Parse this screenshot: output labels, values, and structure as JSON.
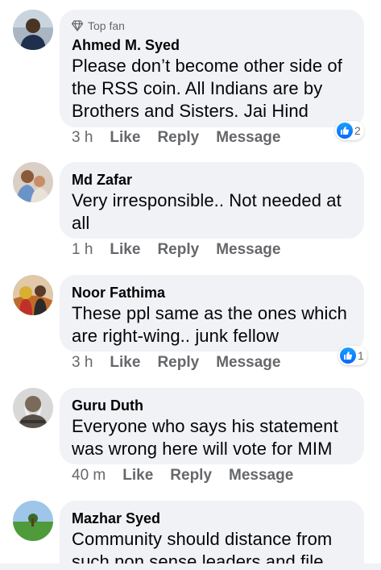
{
  "colors": {
    "bubble": "#f0f2f5",
    "meta_text": "#65676b",
    "like_blue": "#1877f2"
  },
  "comments": [
    {
      "badge": {
        "icon": "diamond-icon",
        "label": "Top fan"
      },
      "author": "Ahmed M. Syed",
      "text_lines": [
        "Please don’t become other side of",
        "the RSS coin. All Indians are by",
        "Brothers and Sisters. Jai Hind"
      ],
      "time": "3 h",
      "like": "Like",
      "reply": "Reply",
      "message": "Message",
      "reactions": {
        "icon": "like-icon",
        "count": "2"
      }
    },
    {
      "author": "Md Zafar",
      "text_lines": [
        "Very irresponsible.. Not needed at",
        "all"
      ],
      "time": "1 h",
      "like": "Like",
      "reply": "Reply",
      "message": "Message"
    },
    {
      "author": "Noor Fathima",
      "text_lines": [
        "These ppl same as the ones which",
        "are right-wing.. junk fellow"
      ],
      "time": "3 h",
      "like": "Like",
      "reply": "Reply",
      "message": "Message",
      "reactions": {
        "icon": "like-icon",
        "count": "1"
      }
    },
    {
      "author": "Guru Duth",
      "text_lines": [
        "Everyone who says his statement",
        "was wrong here will vote for MIM"
      ],
      "time": "40 m",
      "like": "Like",
      "reply": "Reply",
      "message": "Message"
    },
    {
      "author": "Mazhar Syed",
      "text_lines": [
        "Community should distance from",
        "such non sense leaders and file"
      ]
    }
  ]
}
